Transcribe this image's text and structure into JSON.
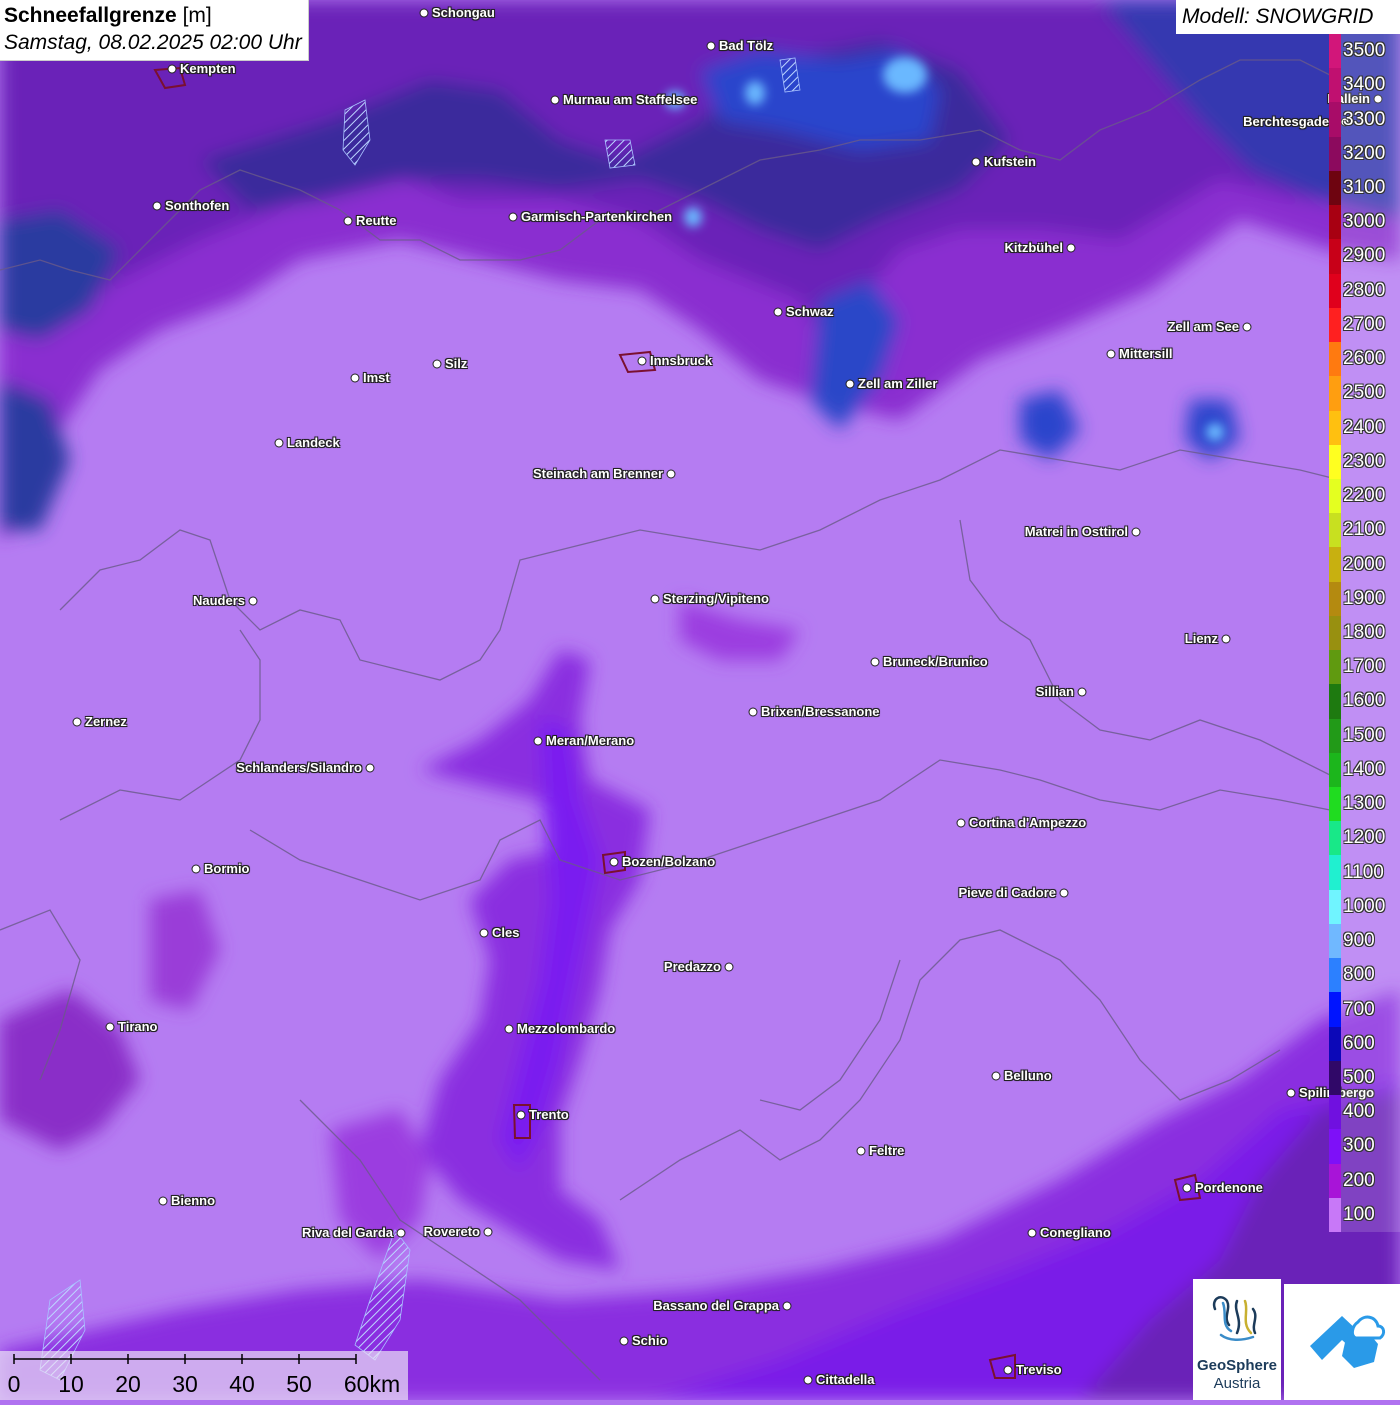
{
  "title": {
    "parameter": "Schneefallgrenze",
    "unit": "[m]",
    "datetime": "Samstag, 08.02.2025 02:00 Uhr"
  },
  "model_label": "Modell: SNOWGRID",
  "legend": {
    "levels": [
      {
        "label": "3500",
        "color": "#d2167a"
      },
      {
        "label": "3400",
        "color": "#c01070"
      },
      {
        "label": "3300",
        "color": "#a80c68"
      },
      {
        "label": "3200",
        "color": "#8c0a5e"
      },
      {
        "label": "3100",
        "color": "#6e0410"
      },
      {
        "label": "3000",
        "color": "#a80012"
      },
      {
        "label": "2900",
        "color": "#c80018"
      },
      {
        "label": "2800",
        "color": "#e0001c"
      },
      {
        "label": "2700",
        "color": "#ff2020"
      },
      {
        "label": "2600",
        "color": "#ff7a10"
      },
      {
        "label": "2500",
        "color": "#ff9e10"
      },
      {
        "label": "2400",
        "color": "#ffc010"
      },
      {
        "label": "2300",
        "color": "#ffff20"
      },
      {
        "label": "2200",
        "color": "#e4ff20"
      },
      {
        "label": "2100",
        "color": "#c8e020"
      },
      {
        "label": "2000",
        "color": "#c8b010"
      },
      {
        "label": "1900",
        "color": "#b48a10"
      },
      {
        "label": "1800",
        "color": "#989010"
      },
      {
        "label": "1700",
        "color": "#609a10"
      },
      {
        "label": "1600",
        "color": "#1e7a10"
      },
      {
        "label": "1500",
        "color": "#229a18"
      },
      {
        "label": "1400",
        "color": "#1cb61c"
      },
      {
        "label": "1300",
        "color": "#20dc20"
      },
      {
        "label": "1200",
        "color": "#18e888"
      },
      {
        "label": "1100",
        "color": "#20f0d0"
      },
      {
        "label": "1000",
        "color": "#70f4ff"
      },
      {
        "label": "900",
        "color": "#70b8ff"
      },
      {
        "label": "800",
        "color": "#2c80ff"
      },
      {
        "label": "700",
        "color": "#0014ff"
      },
      {
        "label": "600",
        "color": "#0c08b8"
      },
      {
        "label": "500",
        "color": "#300868"
      },
      {
        "label": "400",
        "color": "#7010e0"
      },
      {
        "label": "300",
        "color": "#7e10f8"
      },
      {
        "label": "200",
        "color": "#a814d8"
      },
      {
        "label": "100",
        "color": "#c878f8"
      }
    ]
  },
  "places": [
    {
      "name": "Schongau",
      "label_side": "right"
    },
    {
      "name": "Kempten",
      "label_side": "right"
    },
    {
      "name": "Bad Tölz",
      "label_side": "right"
    },
    {
      "name": "Murnau am Staffelsee",
      "label_side": "right"
    },
    {
      "name": "Hallein",
      "label_side": "left"
    },
    {
      "name": "Berchtesgaden",
      "label_side": "left"
    },
    {
      "name": "Kufstein",
      "label_side": "right"
    },
    {
      "name": "Sonthofen",
      "label_side": "right"
    },
    {
      "name": "Reutte",
      "label_side": "right"
    },
    {
      "name": "Garmisch-Partenkirchen",
      "label_side": "right"
    },
    {
      "name": "Kitzbühel",
      "label_side": "left"
    },
    {
      "name": "Schwaz",
      "label_side": "right"
    },
    {
      "name": "Zell am See",
      "label_side": "left"
    },
    {
      "name": "Innsbruck",
      "label_side": "right"
    },
    {
      "name": "Mittersill",
      "label_side": "right"
    },
    {
      "name": "Imst",
      "label_side": "right"
    },
    {
      "name": "Silz",
      "label_side": "right"
    },
    {
      "name": "Zell am Ziller",
      "label_side": "right"
    },
    {
      "name": "Landeck",
      "label_side": "right"
    },
    {
      "name": "Steinach am Brenner",
      "label_side": "left"
    },
    {
      "name": "Matrei in Osttirol",
      "label_side": "left"
    },
    {
      "name": "Nauders",
      "label_side": "left"
    },
    {
      "name": "Sterzing/Vipiteno",
      "label_side": "right"
    },
    {
      "name": "Lienz",
      "label_side": "left"
    },
    {
      "name": "Bruneck/Brunico",
      "label_side": "right"
    },
    {
      "name": "Sillian",
      "label_side": "left"
    },
    {
      "name": "Zernez",
      "label_side": "right"
    },
    {
      "name": "Brixen/Bressanone",
      "label_side": "right"
    },
    {
      "name": "Meran/Merano",
      "label_side": "right"
    },
    {
      "name": "Schlanders/Silandro",
      "label_side": "left"
    },
    {
      "name": "Cortina d'Ampezzo",
      "label_side": "right"
    },
    {
      "name": "Bozen/Bolzano",
      "label_side": "right"
    },
    {
      "name": "Bormio",
      "label_side": "right"
    },
    {
      "name": "Pieve di Cadore",
      "label_side": "left"
    },
    {
      "name": "Cles",
      "label_side": "right"
    },
    {
      "name": "Predazzo",
      "label_side": "left"
    },
    {
      "name": "Tirano",
      "label_side": "right"
    },
    {
      "name": "Mezzolombardo",
      "label_side": "right"
    },
    {
      "name": "Belluno",
      "label_side": "right"
    },
    {
      "name": "Spilimbergo",
      "label_side": "right"
    },
    {
      "name": "Trento",
      "label_side": "right"
    },
    {
      "name": "Feltre",
      "label_side": "right"
    },
    {
      "name": "Pordenone",
      "label_side": "right"
    },
    {
      "name": "Bienno",
      "label_side": "right"
    },
    {
      "name": "Riva del Garda",
      "label_side": "left"
    },
    {
      "name": "Rovereto",
      "label_side": "left"
    },
    {
      "name": "Conegliano",
      "label_side": "right"
    },
    {
      "name": "Bassano del Grappa",
      "label_side": "left"
    },
    {
      "name": "Schio",
      "label_side": "right"
    },
    {
      "name": "Treviso",
      "label_side": "right"
    },
    {
      "name": "Cittadella",
      "label_side": "right"
    }
  ],
  "scalebar": {
    "ticks": [
      "0",
      "10",
      "20",
      "30",
      "40",
      "50",
      "60km"
    ]
  },
  "logos": {
    "geosphere_line1": "GeoSphere",
    "geosphere_line2": "Austria"
  }
}
